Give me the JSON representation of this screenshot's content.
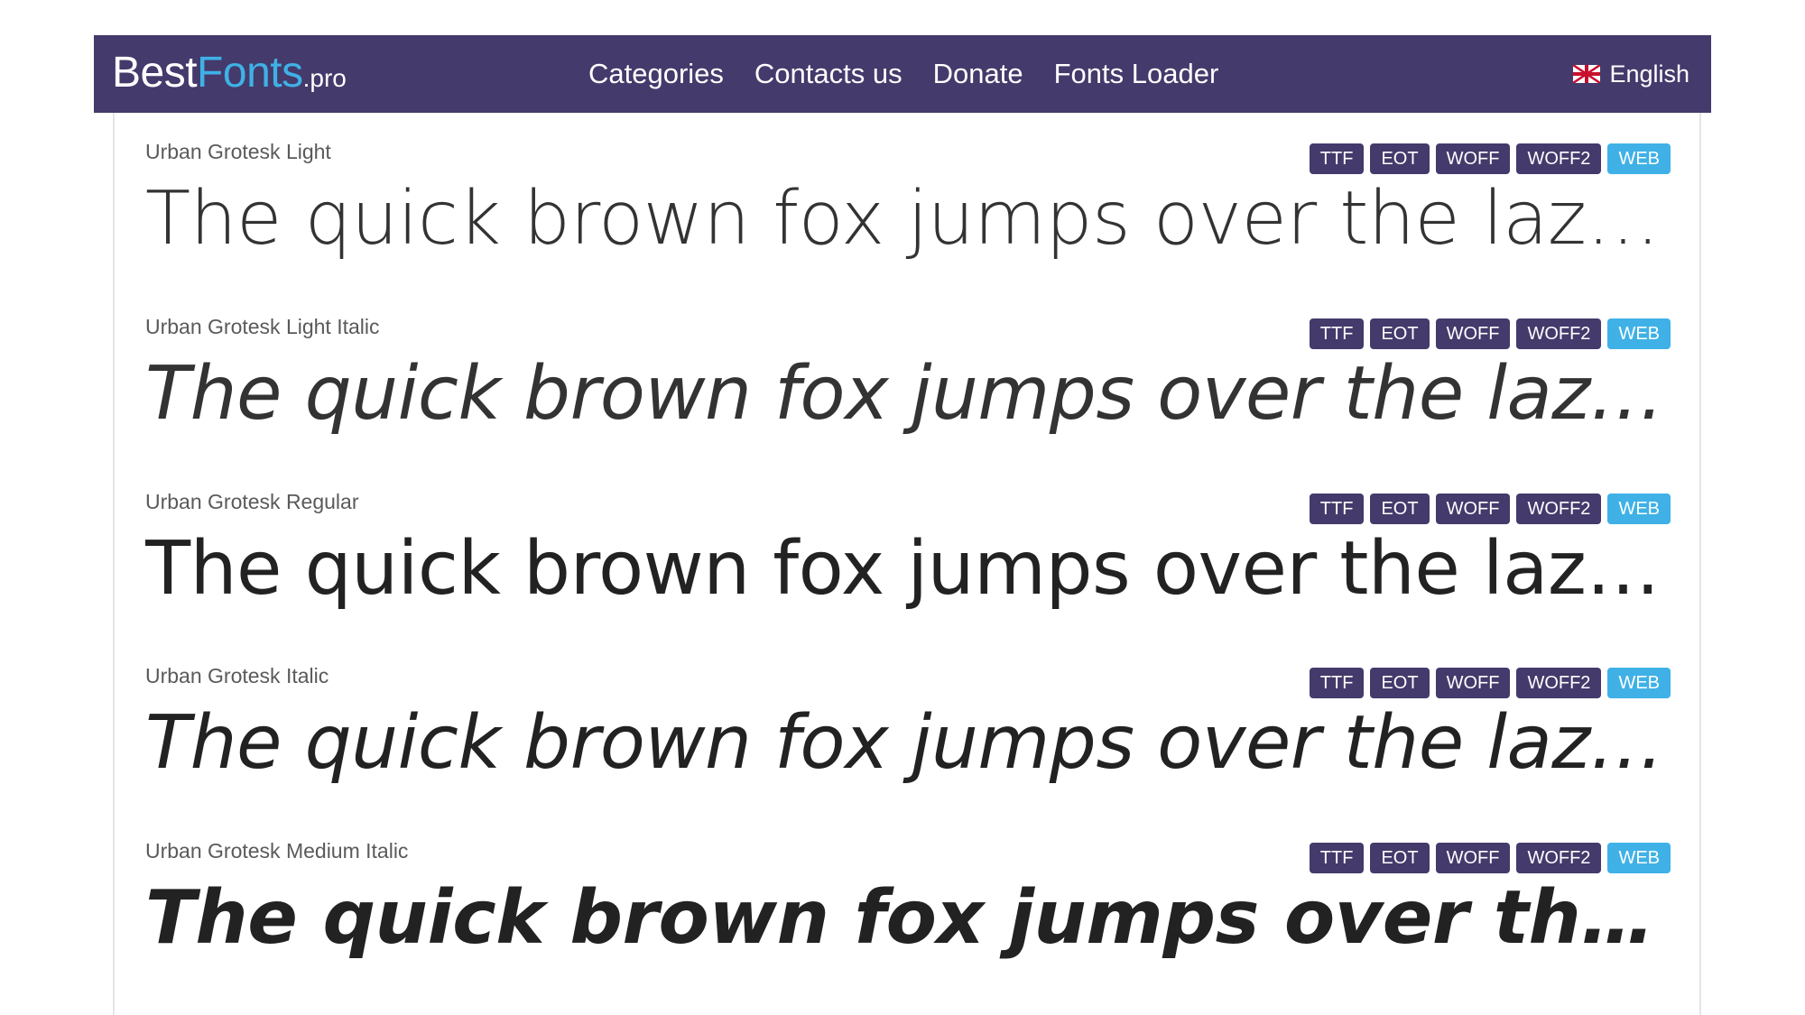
{
  "header": {
    "logo": {
      "best": "Best",
      "fonts": "Fonts",
      "tld": ".pro"
    },
    "nav": [
      "Categories",
      "Contacts us",
      "Donate",
      "Fonts Loader"
    ],
    "language": {
      "flag_icon": "uk-flag-icon",
      "label": "English"
    }
  },
  "colors": {
    "navbar_bg": "#443a6b",
    "accent_blue": "#3fb1e6",
    "badge_bg": "#443a6b"
  },
  "fonts": [
    {
      "name": "Urban Grotesk Light",
      "sample": "The quick brown fox jumps over the lazy dog.",
      "formats": [
        "TTF",
        "EOT",
        "WOFF",
        "WOFF2",
        "WEB"
      ]
    },
    {
      "name": "Urban Grotesk Light Italic",
      "sample": "The quick brown fox jumps over the lazy d...",
      "formats": [
        "TTF",
        "EOT",
        "WOFF",
        "WOFF2",
        "WEB"
      ]
    },
    {
      "name": "Urban Grotesk Regular",
      "sample": "The quick brown fox jumps over the lazy d...",
      "formats": [
        "TTF",
        "EOT",
        "WOFF",
        "WOFF2",
        "WEB"
      ]
    },
    {
      "name": "Urban Grotesk Italic",
      "sample": "The quick brown fox jumps over the lazy d...",
      "formats": [
        "TTF",
        "EOT",
        "WOFF",
        "WOFF2",
        "WEB"
      ]
    },
    {
      "name": "Urban Grotesk Medium Italic",
      "sample": "The quick brown fox jumps over the lazy d...",
      "formats": [
        "TTF",
        "EOT",
        "WOFF",
        "WOFF2",
        "WEB"
      ]
    }
  ]
}
